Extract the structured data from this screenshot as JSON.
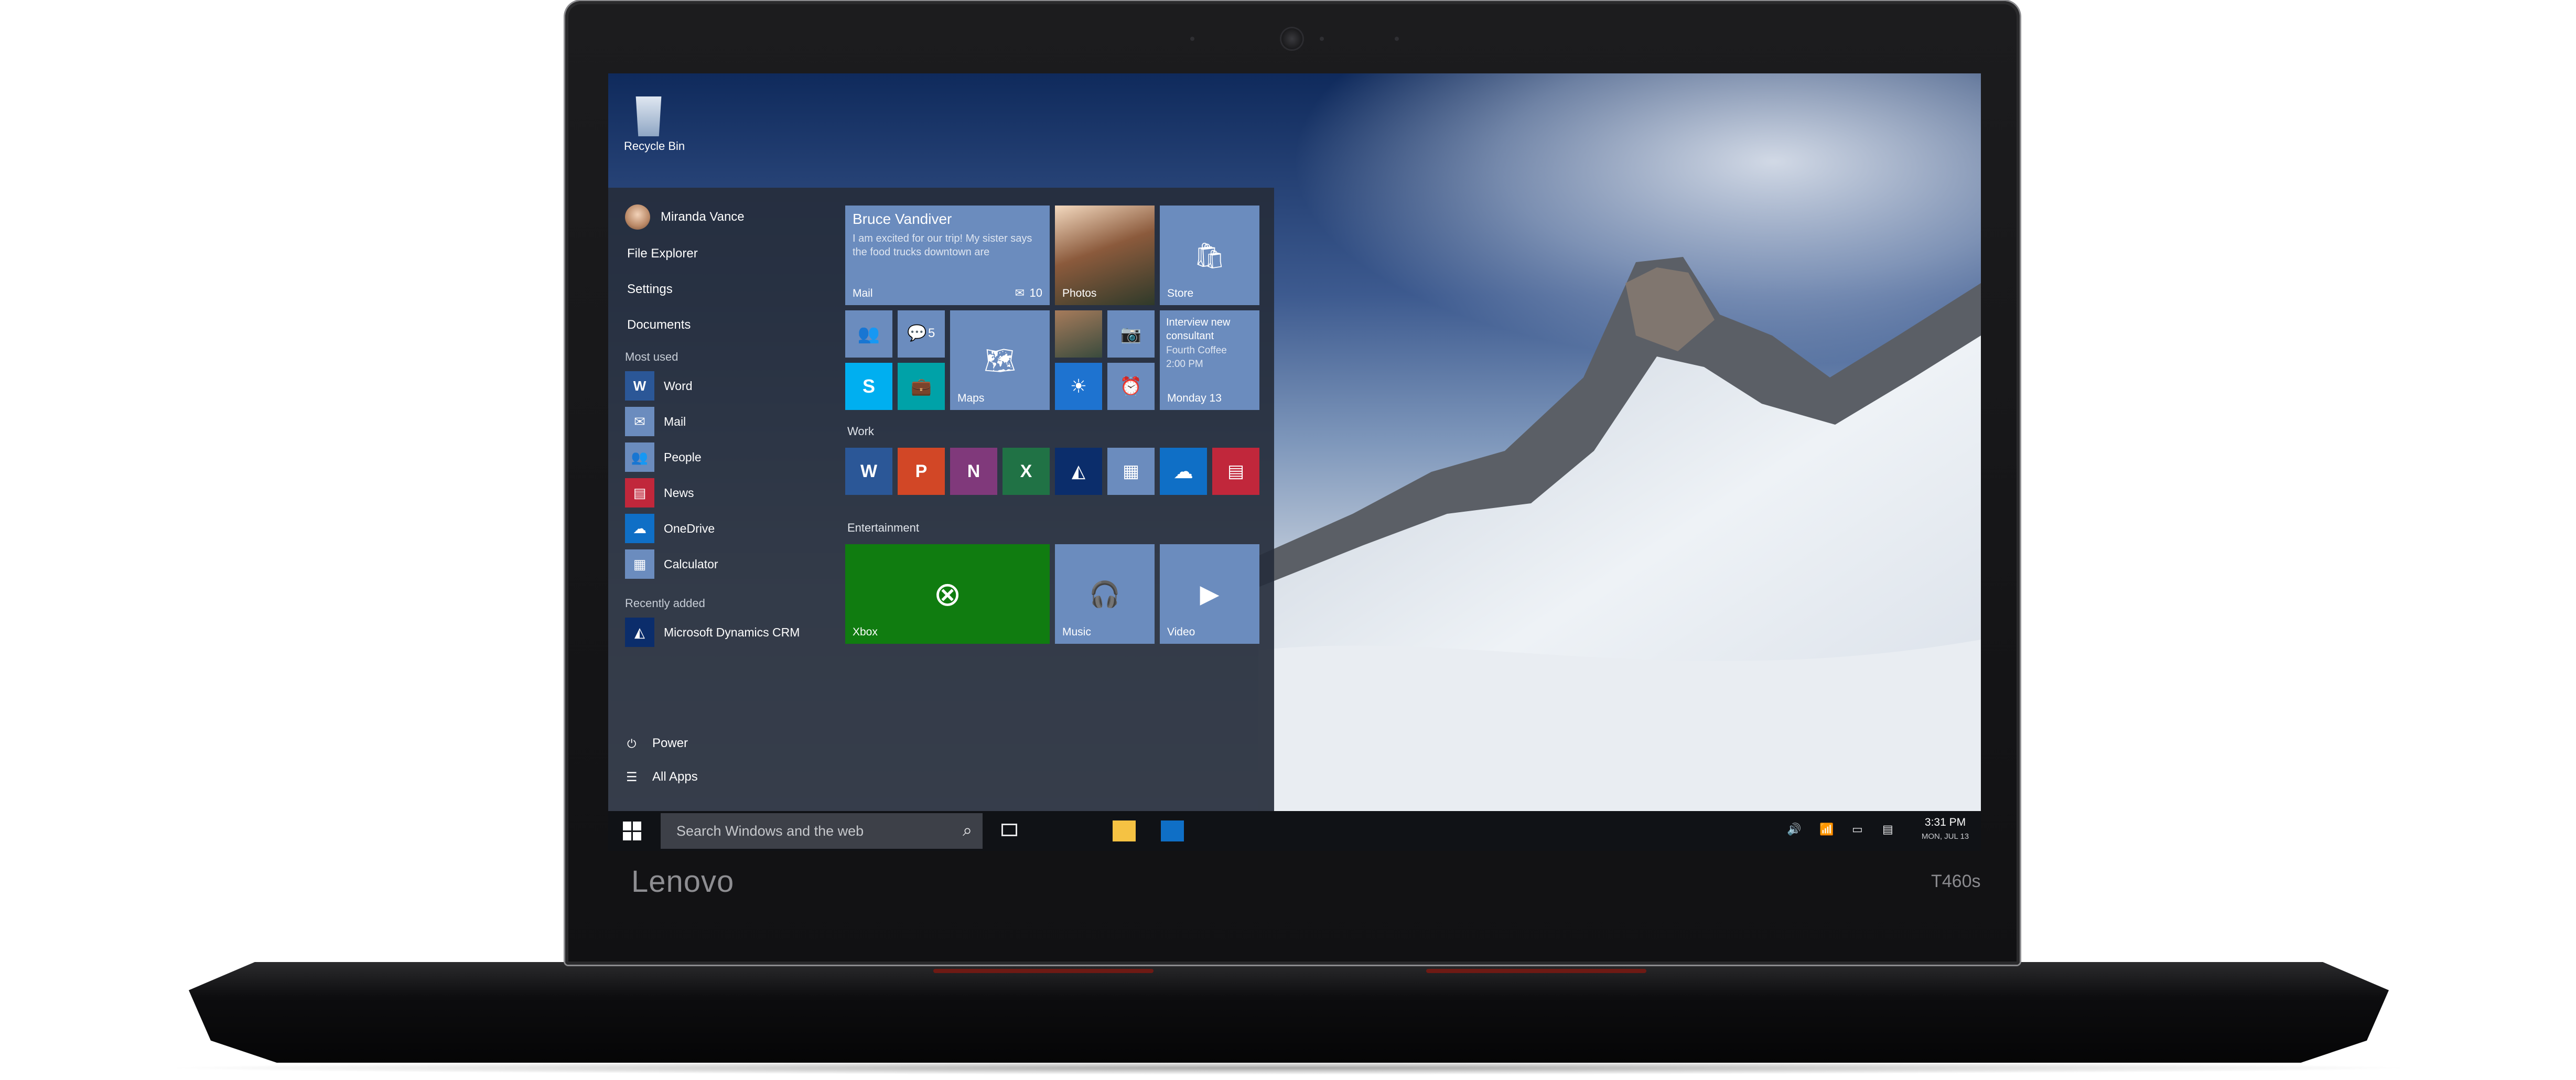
{
  "brand": "Lenovo",
  "model": "T460s",
  "desktop": {
    "recycle_bin_label": "Recycle Bin"
  },
  "start_menu": {
    "user_name": "Miranda Vance",
    "places": [
      "File Explorer",
      "Settings",
      "Documents"
    ],
    "most_used_heading": "Most used",
    "most_used": [
      {
        "label": "Word",
        "icon": "word-icon",
        "color": "#2b5797"
      },
      {
        "label": "Mail",
        "icon": "mail-icon",
        "color": "#6b8cbe"
      },
      {
        "label": "People",
        "icon": "people-icon",
        "color": "#6b8cbe"
      },
      {
        "label": "News",
        "icon": "news-icon",
        "color": "#c1273b"
      },
      {
        "label": "OneDrive",
        "icon": "onedrive-icon",
        "color": "#0f6fc6"
      },
      {
        "label": "Calculator",
        "icon": "calculator-icon",
        "color": "#6b8cbe"
      }
    ],
    "recently_added_heading": "Recently added",
    "recently_added": {
      "label": "Microsoft Dynamics CRM",
      "icon": "dynamics-crm-icon",
      "color": "#0b2d6b"
    },
    "power_label": "Power",
    "all_apps_label": "All Apps",
    "tiles": {
      "mail": {
        "sender": "Bruce Vandiver",
        "preview": "I am excited for our trip! My sister says the food trucks downtown are",
        "label": "Mail",
        "count": "10"
      },
      "photos": {
        "label": "Photos"
      },
      "store": {
        "label": "Store"
      },
      "messaging_count": "5",
      "maps": {
        "label": "Maps"
      },
      "calendar": {
        "event": "Interview new consultant",
        "location": "Fourth Coffee",
        "time": "2:00 PM",
        "date": "Monday 13"
      },
      "work_heading": "Work",
      "entertainment_heading": "Entertainment",
      "xbox": {
        "label": "Xbox",
        "color": "#107c10"
      },
      "music": {
        "label": "Music"
      },
      "video": {
        "label": "Video"
      }
    },
    "colors": {
      "tile_blue": "#6b8cbe",
      "skype": "#00aff0",
      "teal": "#00a2a8"
    }
  },
  "taskbar": {
    "search_placeholder": "Search Windows and the web",
    "time": "3:31 PM",
    "date": "MON, JUL 13"
  }
}
